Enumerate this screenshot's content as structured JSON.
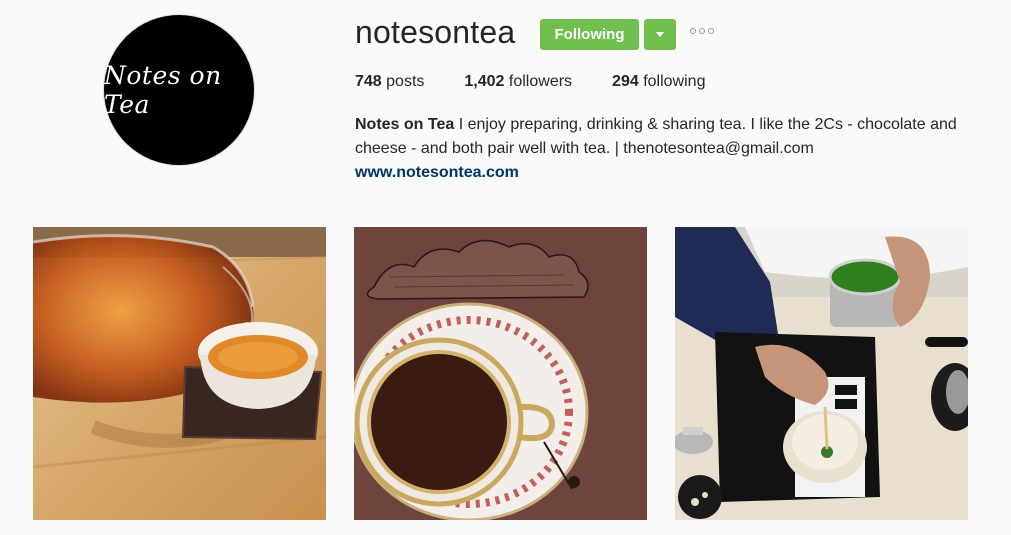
{
  "profile": {
    "avatar_text": "Notes on Tea",
    "username": "notesontea",
    "follow_label": "Following",
    "more_icon": "ellipsis-icon",
    "dropdown_icon": "caret-down-icon"
  },
  "stats": {
    "posts_count": "748",
    "posts_label": "posts",
    "followers_count": "1,402",
    "followers_label": "followers",
    "following_count": "294",
    "following_label": "following"
  },
  "bio": {
    "name": "Notes on Tea",
    "text": " I enjoy preparing, drinking & sharing tea. I like the 2Cs - chocolate and cheese - and both pair well with tea. | thenotesontea@gmail.com",
    "link": "www.notesontea.com"
  },
  "colors": {
    "follow_green": "#70c050",
    "link_blue": "#003569"
  }
}
